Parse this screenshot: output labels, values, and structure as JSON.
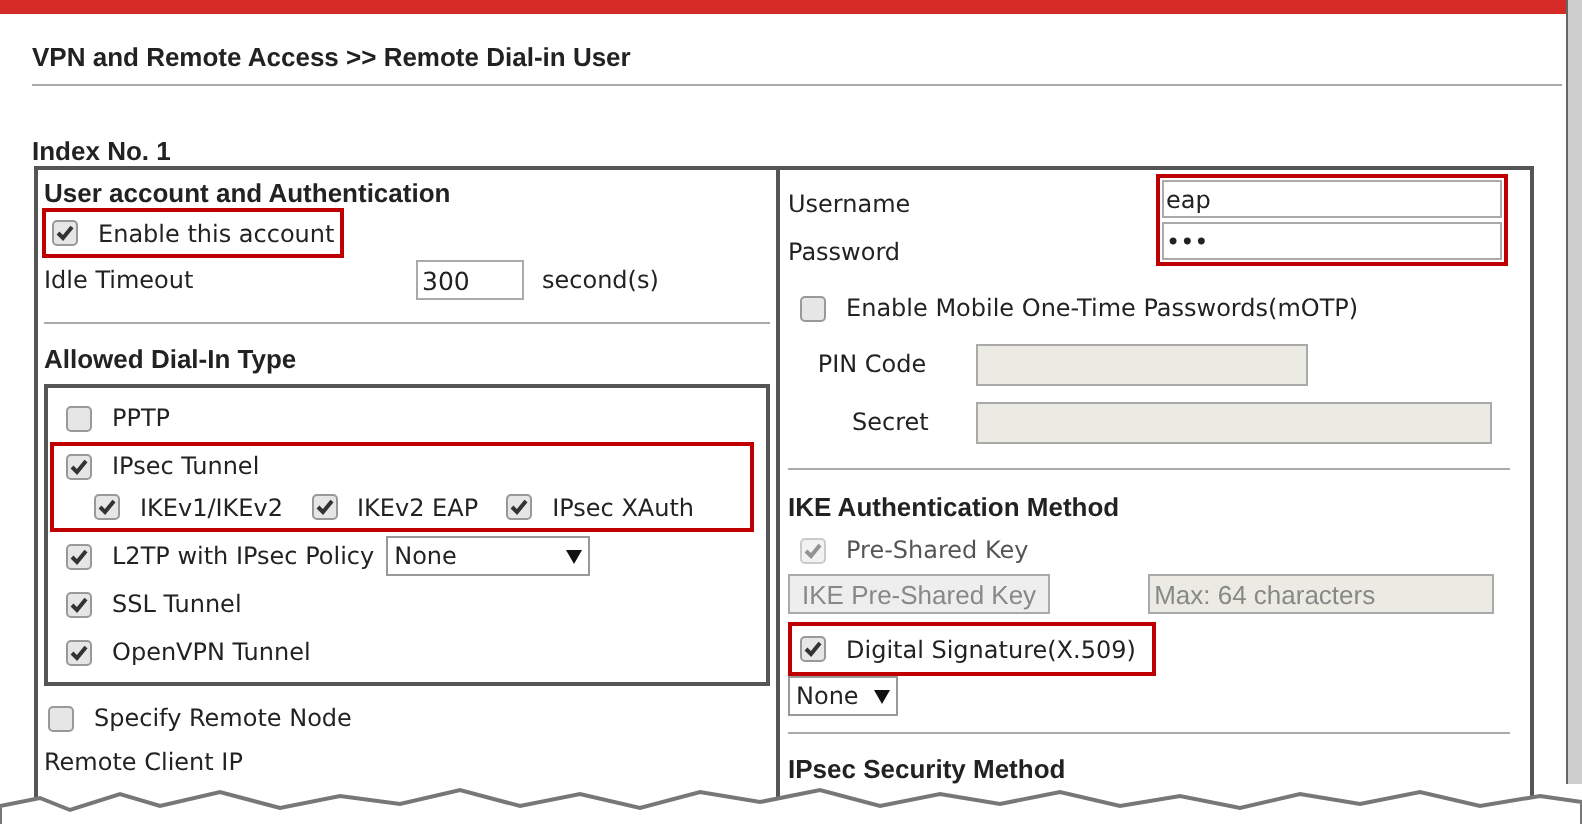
{
  "header": {
    "title": "VPN and Remote Access >> Remote Dial-in User"
  },
  "index_label": "Index No. 1",
  "left": {
    "section_title": "User account and Authentication",
    "enable_account": {
      "label": "Enable this account",
      "checked": true,
      "highlighted": true
    },
    "idle_timeout": {
      "label": "Idle Timeout",
      "value": "300",
      "unit": "second(s)"
    },
    "dial_in": {
      "title": "Allowed Dial-In Type",
      "items": [
        {
          "label": "PPTP",
          "checked": false,
          "highlighted": false
        },
        {
          "label": "IPsec Tunnel",
          "checked": true,
          "highlighted": true,
          "children": [
            {
              "label": "IKEv1/IKEv2",
              "checked": true
            },
            {
              "label": "IKEv2 EAP",
              "checked": true
            },
            {
              "label": "IPsec XAuth",
              "checked": true
            }
          ]
        },
        {
          "label": "L2TP with IPsec Policy",
          "checked": true,
          "highlighted": false,
          "select": "None"
        },
        {
          "label": "SSL Tunnel",
          "checked": true,
          "highlighted": false
        },
        {
          "label": "OpenVPN Tunnel",
          "checked": true,
          "highlighted": false
        }
      ]
    },
    "remote_node": {
      "label": "Specify Remote Node",
      "checked": false
    },
    "remote_client_ip": {
      "label": "Remote Client IP"
    }
  },
  "right": {
    "credentials": {
      "highlighted": true,
      "username": {
        "label": "Username",
        "value": "eap"
      },
      "password": {
        "label": "Password",
        "value": "•••"
      }
    },
    "motp": {
      "label": "Enable Mobile One-Time Passwords(mOTP)",
      "checked": false
    },
    "pin_code": {
      "label": "PIN Code",
      "disabled": true
    },
    "secret": {
      "label": "Secret",
      "disabled": true
    },
    "ike": {
      "title": "IKE Authentication Method",
      "pre_shared_key": {
        "label": "Pre-Shared Key",
        "checked": true,
        "disabled": true
      },
      "psk_button": {
        "label": "IKE Pre-Shared Key",
        "disabled": true
      },
      "psk_field": {
        "placeholder": "Max: 64 characters",
        "disabled": true
      },
      "digital_signature": {
        "label": "Digital Signature(X.509)",
        "checked": true,
        "highlighted": true
      },
      "certificate_select": "None"
    },
    "ipsec_security": {
      "title": "IPsec Security Method"
    }
  }
}
